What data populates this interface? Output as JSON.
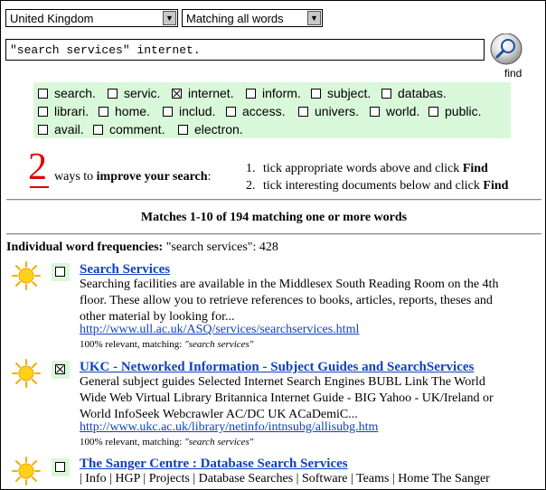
{
  "search": {
    "country": "United Kingdom",
    "match_mode": "Matching all words",
    "query": "\"search services\" internet.",
    "find_label": "find"
  },
  "words": [
    {
      "label": "search.",
      "checked": false
    },
    {
      "label": "servic.",
      "checked": false
    },
    {
      "label": "internet.",
      "checked": true
    },
    {
      "label": "inform.",
      "checked": false
    },
    {
      "label": "subject.",
      "checked": false
    },
    {
      "label": "databas.",
      "checked": false
    },
    {
      "label": "librari.",
      "checked": false
    },
    {
      "label": "home.",
      "checked": false
    },
    {
      "label": "includ.",
      "checked": false
    },
    {
      "label": "access.",
      "checked": false
    },
    {
      "label": "univers.",
      "checked": false
    },
    {
      "label": "world.",
      "checked": false
    },
    {
      "label": "public.",
      "checked": false
    },
    {
      "label": "avail.",
      "checked": false
    },
    {
      "label": "comment.",
      "checked": false
    },
    {
      "label": "electron.",
      "checked": false
    }
  ],
  "tips": {
    "count": "2",
    "prefix": "ways to",
    "emphasis": "improve your search",
    "suffix": ":",
    "steps": [
      {
        "num": "1.",
        "text": "tick appropriate words above and click",
        "action": "Find"
      },
      {
        "num": "2.",
        "text": "tick interesting documents below and click",
        "action": "Find"
      }
    ]
  },
  "summary": {
    "matches": "Matches 1-10 of 194 matching one or more words",
    "freq_label": "Individual word frequencies:",
    "freq_value": "\"search services\": 428"
  },
  "results": [
    {
      "title": "Search Services",
      "checked": false,
      "desc": [
        "Searching facilities are available in the Middlesex South Reading Room on the 4th",
        "floor. These allow you to retrieve references to books, articles, reports, theses and",
        "other material by looking for..."
      ],
      "url": "http://www.ull.ac.uk/ASQ/services/searchservices.html",
      "relevance": "100% relevant, matching:",
      "matching": "\"search services\""
    },
    {
      "title": "UKC - Networked Information - Subject Guides and SearchServices",
      "checked": true,
      "desc": [
        "General subject guides Selected Internet Search Engines BUBL Link The World",
        "Wide Web Virtual Library Britannica Internet Guide - BIG Yahoo - UK/Ireland or",
        "World InfoSeek Webcrawler AC/DC UK ACaDemiC..."
      ],
      "url": "http://www.ukc.ac.uk/library/netinfo/intnsubg/allisubg.htm",
      "relevance": "100% relevant, matching:",
      "matching": "\"search services\""
    },
    {
      "title": "The Sanger Centre : Database Search Services",
      "checked": false,
      "desc": [
        "| Info | HGP | Projects | Database Searches | Software | Teams | Home The Sanger"
      ],
      "url": "",
      "relevance": "",
      "matching": ""
    }
  ],
  "colors": {
    "accent_green": "#d9f7d9",
    "link": "#1040c0",
    "highlight_red": "#e00000"
  }
}
